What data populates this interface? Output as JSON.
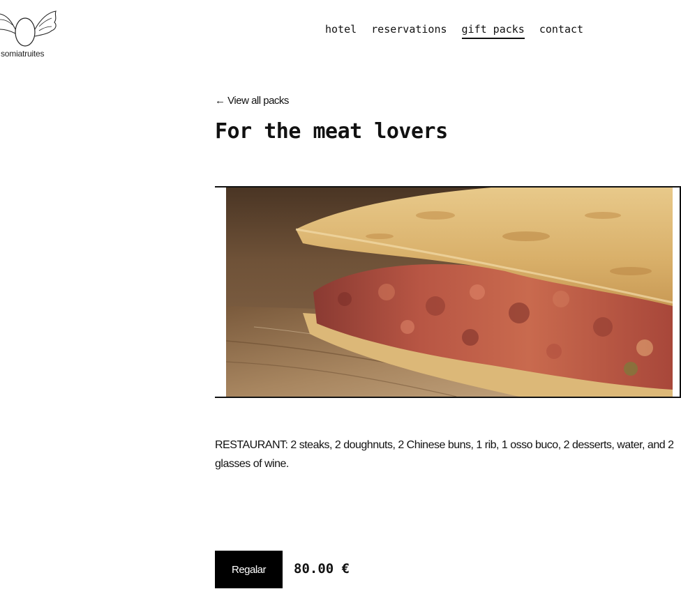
{
  "header": {
    "logo_text": "somiatruites",
    "nav": [
      {
        "label": "hotel",
        "active": false
      },
      {
        "label": "reservations",
        "active": false
      },
      {
        "label": "gift packs",
        "active": true
      },
      {
        "label": "contact",
        "active": false
      }
    ]
  },
  "main": {
    "back_link": "← View all packs",
    "title": "For the meat lovers",
    "image_subject": "flatbread filled with shredded meat on a wooden board",
    "description": "RESTAURANT: 2 steaks, 2 doughnuts, 2 Chinese buns, 1 rib, 1 osso buco, 2 desserts, water, and 2 glasses of wine.",
    "button_label": "Regalar",
    "price": "80.00 €"
  },
  "colors": {
    "text": "#111111",
    "button_bg": "#000000",
    "button_text": "#ffffff",
    "background": "#ffffff"
  }
}
